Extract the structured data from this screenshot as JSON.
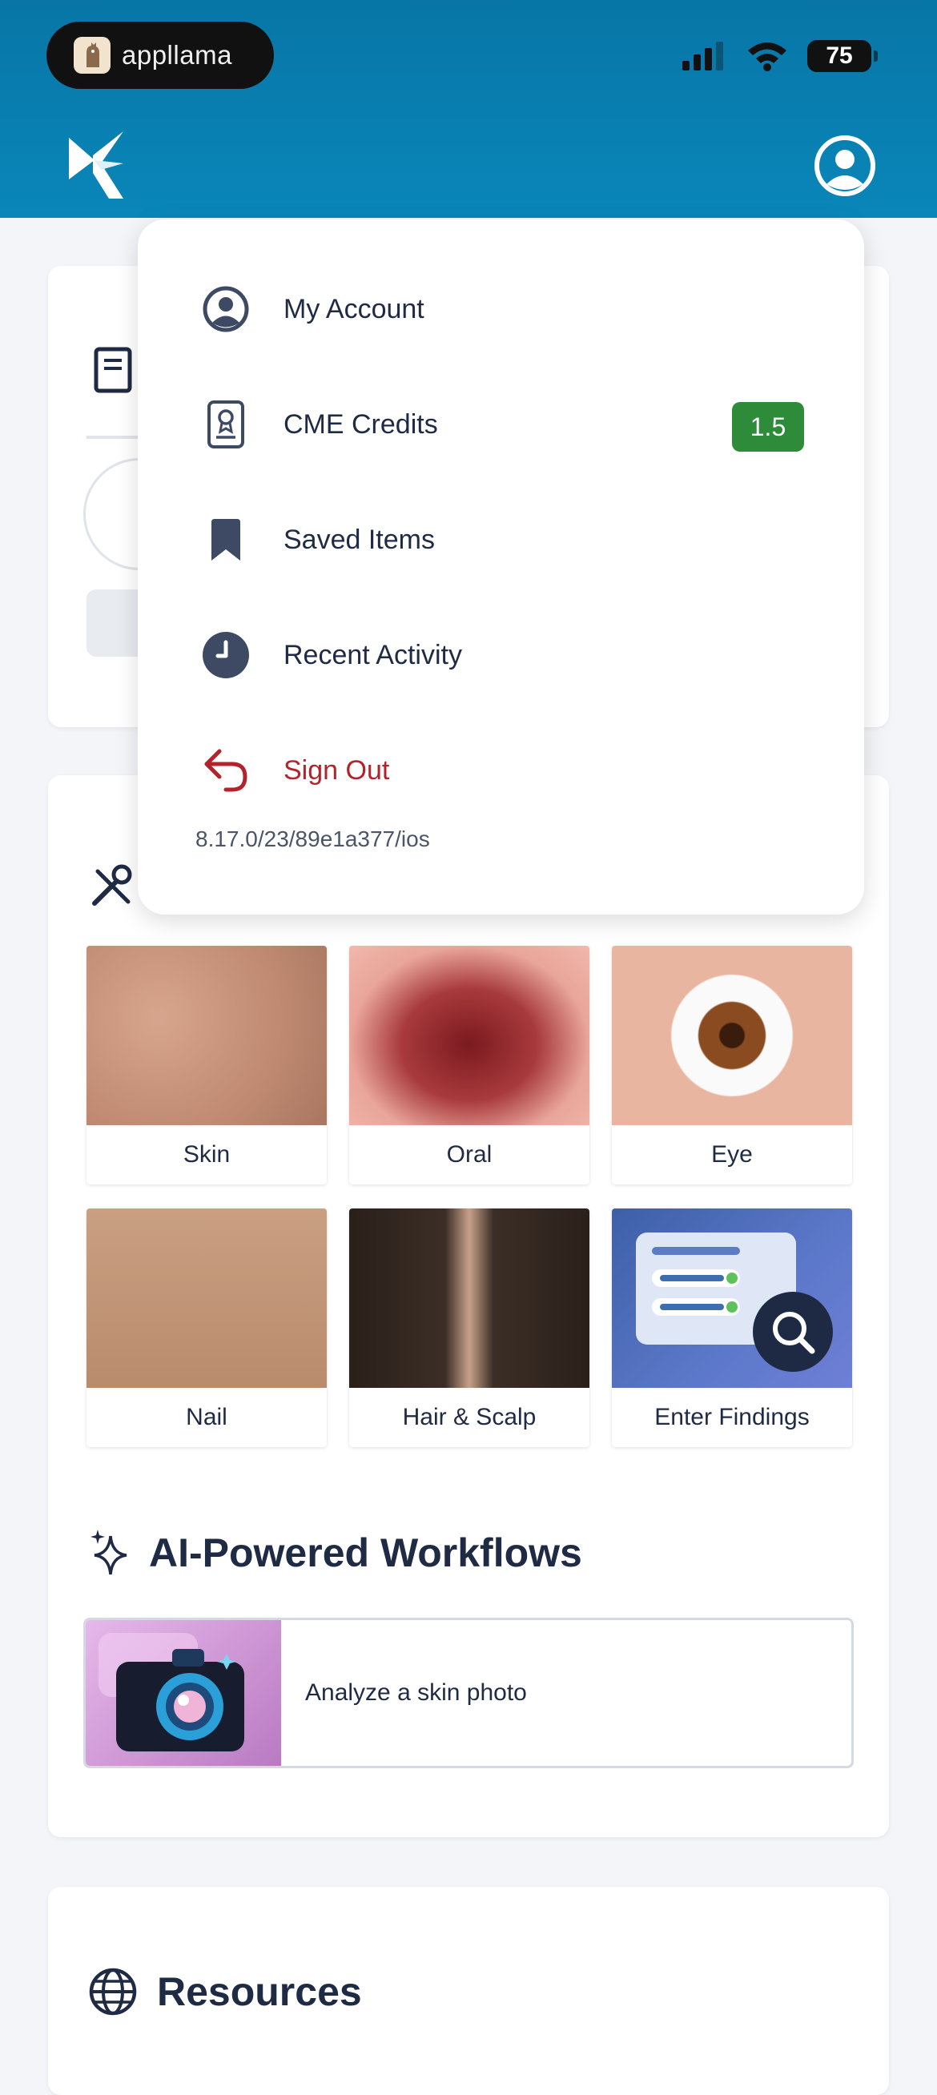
{
  "status_bar": {
    "pill_app_name": "appllama",
    "battery_level": "75"
  },
  "menu": {
    "items": [
      {
        "label": "My Account",
        "icon": "account-circle-icon"
      },
      {
        "label": "CME Credits",
        "icon": "certificate-icon",
        "badge": "1.5"
      },
      {
        "label": "Saved Items",
        "icon": "bookmark-icon"
      },
      {
        "label": "Recent Activity",
        "icon": "clock-icon"
      },
      {
        "label": "Sign Out",
        "icon": "sign-out-arrow-icon"
      }
    ],
    "version": "8.17.0/23/89e1a377/ios"
  },
  "categories": [
    {
      "label": "Skin"
    },
    {
      "label": "Oral"
    },
    {
      "label": "Eye"
    },
    {
      "label": "Nail"
    },
    {
      "label": "Hair & Scalp"
    },
    {
      "label": "Enter Findings"
    }
  ],
  "ai_section": {
    "title": "AI-Powered Workflows",
    "items": [
      {
        "label": "Analyze a skin photo"
      }
    ]
  },
  "resources": {
    "title": "Resources"
  },
  "colors": {
    "header": "#0a86b9",
    "badge": "#2e8b3a",
    "sign_out": "#b3232b",
    "text": "#1f2a44"
  }
}
